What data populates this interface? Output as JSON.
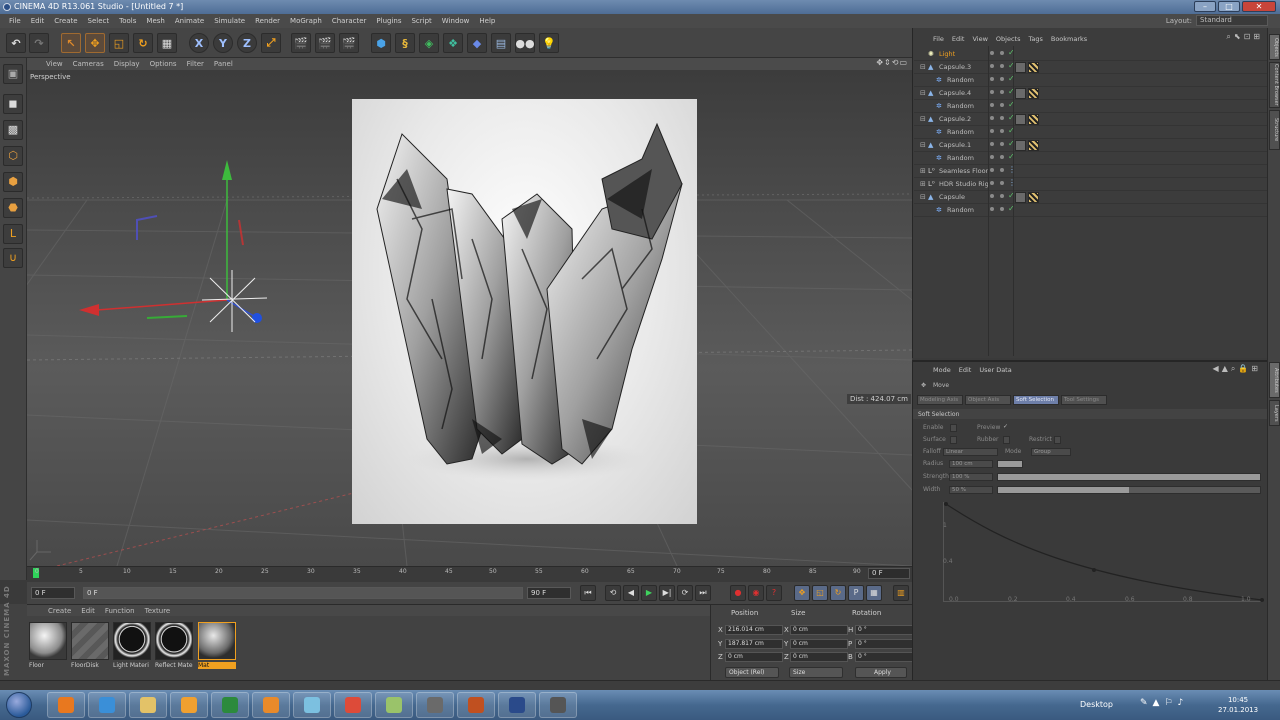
{
  "window": {
    "title": "CINEMA 4D R13.061 Studio - [Untitled 7 *]"
  },
  "menu": [
    "File",
    "Edit",
    "Create",
    "Select",
    "Tools",
    "Mesh",
    "Animate",
    "Simulate",
    "Render",
    "MoGraph",
    "Character",
    "Plugins",
    "Script",
    "Window",
    "Help"
  ],
  "layout": {
    "label": "Layout:",
    "value": "Standard"
  },
  "toolbar": {
    "icons": [
      "undo-icon",
      "redo-icon",
      "live-selection-icon",
      "move-icon",
      "scale-icon",
      "rotate-icon",
      "recent-tool-icon",
      "x-axis-icon",
      "y-axis-icon",
      "z-axis-icon",
      "coordinate-system-icon",
      "render-view-icon",
      "render-picture-viewer-icon",
      "edit-render-settings-icon",
      "cube-icon",
      "bend-icon",
      "array-icon",
      "hypernurbs-icon",
      "floor-icon",
      "camera-icon",
      "light-icon"
    ],
    "axis_labels": [
      "X",
      "Y",
      "Z"
    ]
  },
  "viewport": {
    "menu": [
      "View",
      "Cameras",
      "Display",
      "Options",
      "Filter",
      "Panel"
    ],
    "label": "Perspective",
    "distance": "Dist : 424.07 cm"
  },
  "timeline": {
    "ticks": [
      "0",
      "5",
      "10",
      "15",
      "20",
      "25",
      "30",
      "35",
      "40",
      "45",
      "50",
      "55",
      "60",
      "65",
      "70",
      "75",
      "80",
      "85",
      "90"
    ],
    "current_frame": "0 F"
  },
  "transport": {
    "start": "0 F",
    "mid": "0 F",
    "end_min": "90 F",
    "end": "90 F"
  },
  "materials": {
    "menu": [
      "Create",
      "Edit",
      "Function",
      "Texture"
    ],
    "items": [
      {
        "name": "Floor"
      },
      {
        "name": "FloorDisk"
      },
      {
        "name": "Light Materi"
      },
      {
        "name": "Reflect Mate"
      },
      {
        "name": "Mat"
      }
    ]
  },
  "coords": {
    "headers": [
      "Position",
      "Size",
      "Rotation"
    ],
    "rows": [
      {
        "axis": "X",
        "pos": "216.014 cm",
        "size_axis": "X",
        "size": "0 cm",
        "rot_axis": "H",
        "rot": "0 °"
      },
      {
        "axis": "Y",
        "pos": "187.817 cm",
        "size_axis": "Y",
        "size": "0 cm",
        "rot_axis": "P",
        "rot": "0 °"
      },
      {
        "axis": "Z",
        "pos": "0 cm",
        "size_axis": "Z",
        "size": "0 cm",
        "rot_axis": "B",
        "rot": "0 °"
      }
    ],
    "mode": "Object (Rel)",
    "size_mode": "Size",
    "apply": "Apply"
  },
  "brand": "MAXON CINEMA 4D",
  "objects": {
    "menu": [
      "File",
      "Edit",
      "View",
      "Objects",
      "Tags",
      "Bookmarks"
    ],
    "rows": [
      {
        "name": "Light",
        "indent": 0,
        "icon": "light-icon",
        "tags": false,
        "highlight": true
      },
      {
        "name": "Capsule.3",
        "indent": 0,
        "icon": "capsule-icon",
        "tags": true
      },
      {
        "name": "Random",
        "indent": 1,
        "icon": "random-effector-icon",
        "tags": false
      },
      {
        "name": "Capsule.4",
        "indent": 0,
        "icon": "capsule-icon",
        "tags": true
      },
      {
        "name": "Random",
        "indent": 1,
        "icon": "random-effector-icon",
        "tags": false
      },
      {
        "name": "Capsule.2",
        "indent": 0,
        "icon": "capsule-icon",
        "tags": true
      },
      {
        "name": "Random",
        "indent": 1,
        "icon": "random-effector-icon",
        "tags": false
      },
      {
        "name": "Capsule.1",
        "indent": 0,
        "icon": "capsule-icon",
        "tags": true
      },
      {
        "name": "Random",
        "indent": 1,
        "icon": "random-effector-icon",
        "tags": false
      },
      {
        "name": "Seamless Floor",
        "indent": 0,
        "icon": "null-icon",
        "tags": false
      },
      {
        "name": "HDR Studio Rig",
        "indent": 0,
        "icon": "null-icon",
        "tags": false
      },
      {
        "name": "Capsule",
        "indent": 0,
        "icon": "capsule-icon",
        "tags": true
      },
      {
        "name": "Random",
        "indent": 1,
        "icon": "random-effector-icon",
        "tags": false
      }
    ]
  },
  "attributes": {
    "menu": [
      "Mode",
      "Edit",
      "User Data"
    ],
    "tool_name": "Move",
    "tabs": [
      {
        "label": "Modeling Axis",
        "active": false
      },
      {
        "label": "Object Axis",
        "active": false
      },
      {
        "label": "Soft Selection",
        "active": true
      },
      {
        "label": "Tool Settings",
        "active": false
      }
    ],
    "section": "Soft Selection",
    "enable_label": "Enable",
    "preview_label": "Preview",
    "surface_label": "Surface",
    "rubber_label": "Rubber",
    "restrict_label": "Restrict",
    "falloff_label": "Falloff",
    "falloff_value": "Linear",
    "mode_label": "Mode",
    "mode_value": "Group",
    "radius_label": "Radius",
    "radius_value": "100 cm",
    "strength_label": "Strength",
    "strength_value": "100 %",
    "strength": 1.0,
    "width_label": "Width",
    "width_value": "50 %",
    "width": 0.5,
    "graph_y": [
      "1",
      "0.8",
      "0.4"
    ],
    "graph_x": [
      "0.0",
      "0.2",
      "0.4",
      "0.6",
      "0.8",
      "1.0"
    ]
  },
  "side_tabs": [
    "Objects",
    "Content Browser",
    "Structure",
    "Attributes",
    "Layers"
  ],
  "taskbar": {
    "desktop_label": "Desktop",
    "time": "10:45",
    "date": "27.01.2013",
    "apps": [
      {
        "name": "firefox",
        "color": "#e8781f"
      },
      {
        "name": "internet-explorer",
        "color": "#3a8fd8"
      },
      {
        "name": "explorer",
        "color": "#e3c268"
      },
      {
        "name": "media-player",
        "color": "#f0a030"
      },
      {
        "name": "photoshop",
        "color": "#2c8a3c"
      },
      {
        "name": "blender",
        "color": "#e88a2a"
      },
      {
        "name": "globe",
        "color": "#7cc0e0"
      },
      {
        "name": "chrome",
        "color": "#dd4b39"
      },
      {
        "name": "notepad",
        "color": "#9ac36a"
      },
      {
        "name": "cinema4d-old",
        "color": "#6a6a6a"
      },
      {
        "name": "bridge",
        "color": "#c05020"
      },
      {
        "name": "cinema4d",
        "color": "#2a4a8a"
      },
      {
        "name": "installer",
        "color": "#555555"
      }
    ]
  }
}
